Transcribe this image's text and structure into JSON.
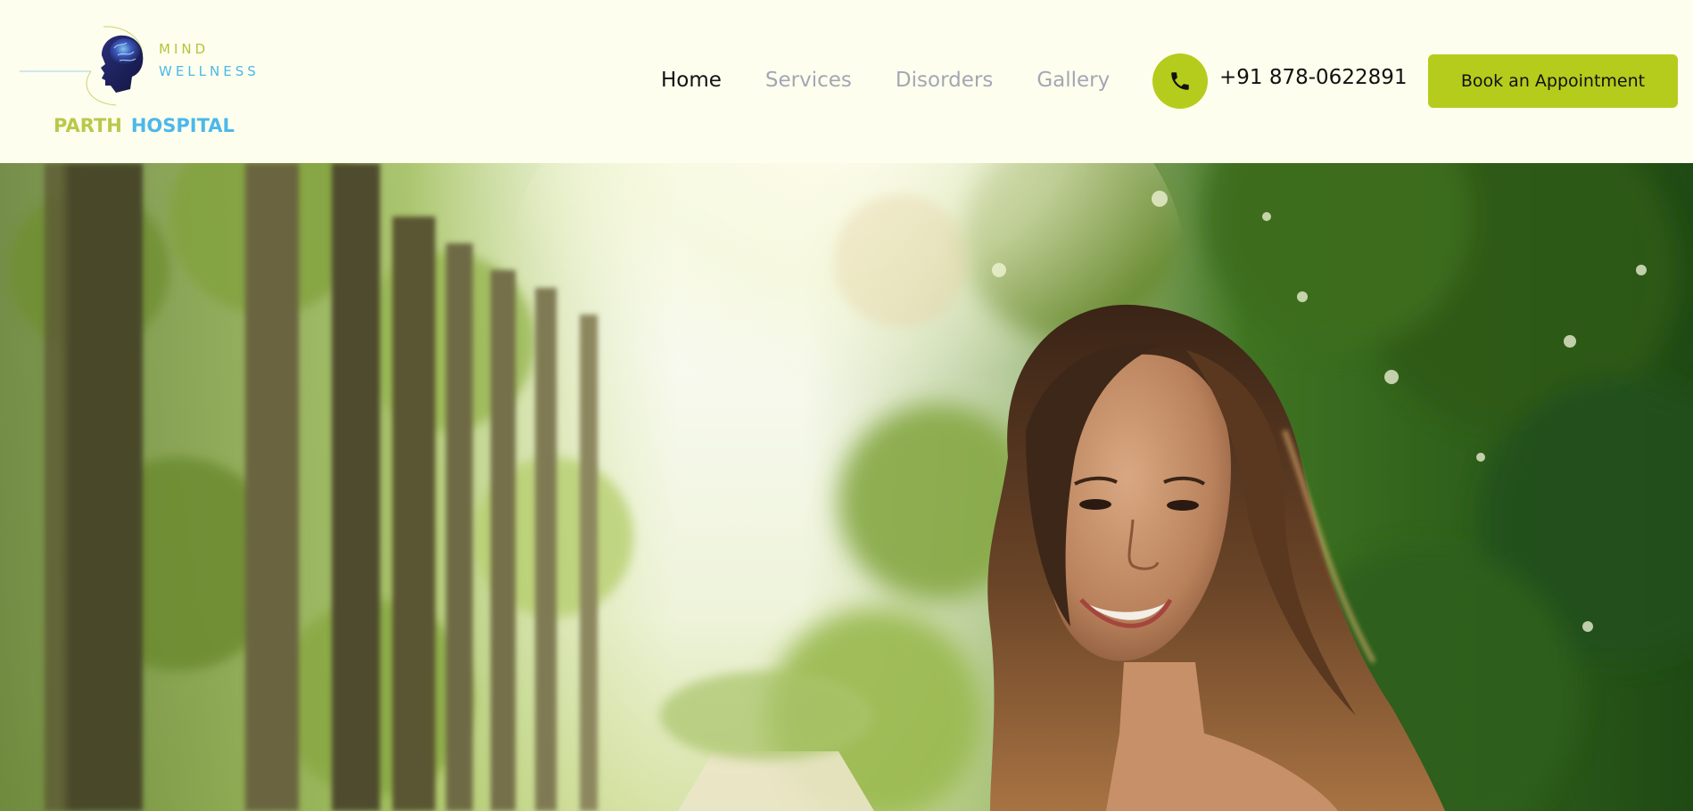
{
  "brand": {
    "logo_word_1": "MIND",
    "logo_word_2": "WELLNESS",
    "name_part_1": "PARTH",
    "name_part_2": "HOSPITAL",
    "icon": "brain-head-icon"
  },
  "nav": {
    "items": [
      {
        "label": "Home",
        "active": true
      },
      {
        "label": "Services",
        "active": false
      },
      {
        "label": "Disorders",
        "active": false
      },
      {
        "label": "Gallery",
        "active": false
      }
    ]
  },
  "contact": {
    "phone": "+91 878-0622891",
    "icon": "phone-icon"
  },
  "cta": {
    "book_label": "Book an Appointment"
  },
  "hero": {
    "image": "smiling-woman-in-forest-photo"
  },
  "colors": {
    "accent": "#b5cc1c",
    "header_bg": "#fefeee",
    "nav_inactive": "#a3a7b3",
    "nav_active": "#111111",
    "logo_green": "#b8c94a",
    "logo_blue": "#4cb8ea"
  }
}
